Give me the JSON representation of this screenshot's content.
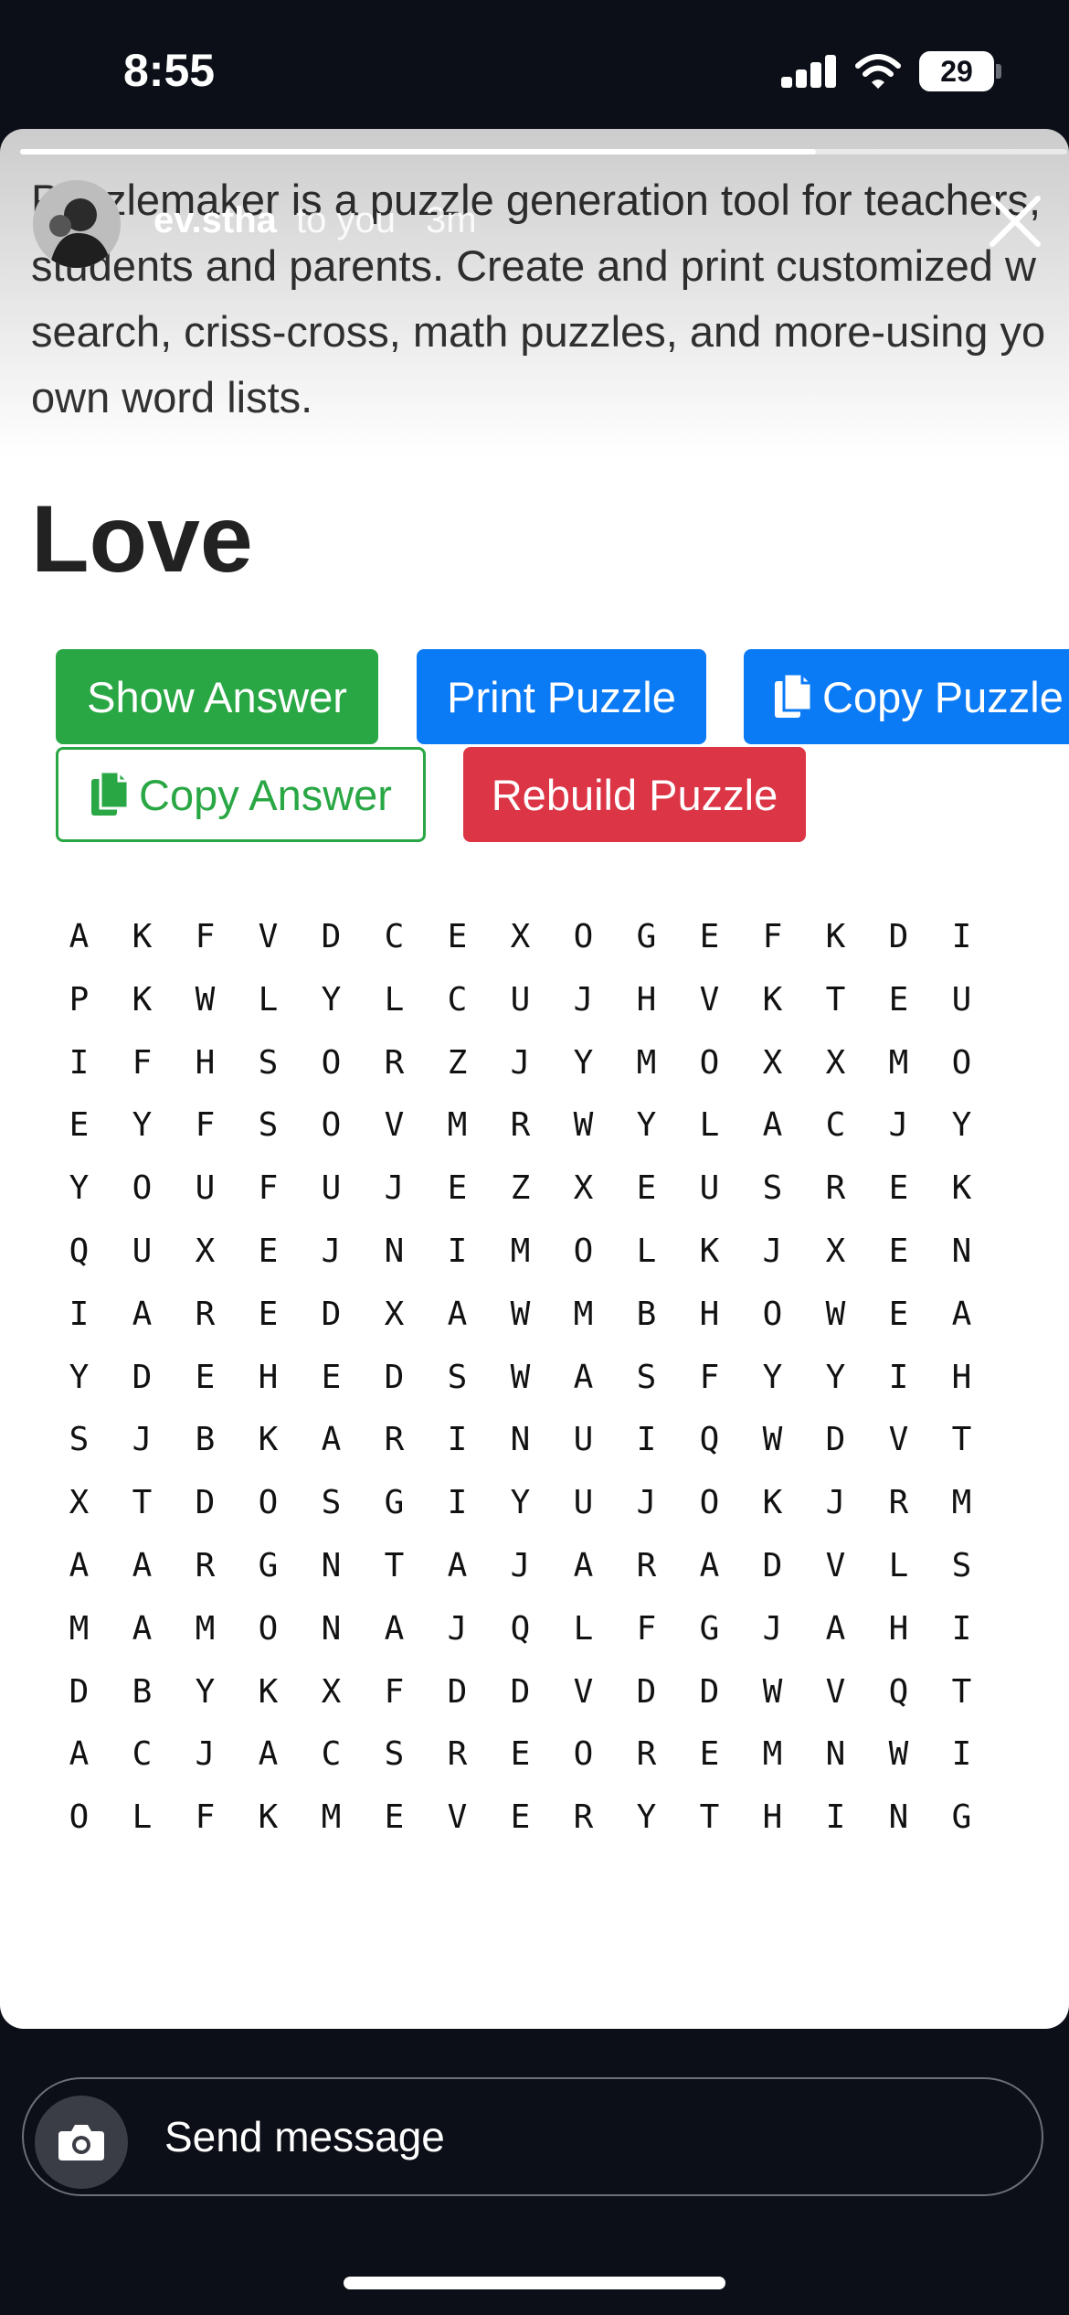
{
  "status_bar": {
    "time": "8:55",
    "battery": "29"
  },
  "story": {
    "progress": 0.76,
    "username": "ev.stha",
    "audience": "to you",
    "age": "3m",
    "intro_lines": [
      "Puzzlemaker is a puzzle generation tool for teachers,",
      "students and parents. Create and print customized w",
      "search, criss-cross, math puzzles, and more-using yo",
      "own word lists."
    ],
    "title": "Love",
    "buttons": {
      "show_answer": "Show Answer",
      "print_puzzle": "Print Puzzle",
      "copy_puzzle": "Copy Puzzle",
      "copy_answer": "Copy Answer",
      "rebuild_puzzle": "Rebuild Puzzle"
    },
    "grid": [
      [
        "A",
        "K",
        "F",
        "V",
        "D",
        "C",
        "E",
        "X",
        "O",
        "G",
        "E",
        "F",
        "K",
        "D",
        "I"
      ],
      [
        "P",
        "K",
        "W",
        "L",
        "Y",
        "L",
        "C",
        "U",
        "J",
        "H",
        "V",
        "K",
        "T",
        "E",
        "U"
      ],
      [
        "I",
        "F",
        "H",
        "S",
        "O",
        "R",
        "Z",
        "J",
        "Y",
        "M",
        "O",
        "X",
        "X",
        "M",
        "O"
      ],
      [
        "E",
        "Y",
        "F",
        "S",
        "O",
        "V",
        "M",
        "R",
        "W",
        "Y",
        "L",
        "A",
        "C",
        "J",
        "Y"
      ],
      [
        "Y",
        "O",
        "U",
        "F",
        "U",
        "J",
        "E",
        "Z",
        "X",
        "E",
        "U",
        "S",
        "R",
        "E",
        "K"
      ],
      [
        "Q",
        "U",
        "X",
        "E",
        "J",
        "N",
        "I",
        "M",
        "O",
        "L",
        "K",
        "J",
        "X",
        "E",
        "N"
      ],
      [
        "I",
        "A",
        "R",
        "E",
        "D",
        "X",
        "A",
        "W",
        "M",
        "B",
        "H",
        "O",
        "W",
        "E",
        "A"
      ],
      [
        "Y",
        "D",
        "E",
        "H",
        "E",
        "D",
        "S",
        "W",
        "A",
        "S",
        "F",
        "Y",
        "Y",
        "I",
        "H"
      ],
      [
        "S",
        "J",
        "B",
        "K",
        "A",
        "R",
        "I",
        "N",
        "U",
        "I",
        "Q",
        "W",
        "D",
        "V",
        "T"
      ],
      [
        "X",
        "T",
        "D",
        "O",
        "S",
        "G",
        "I",
        "Y",
        "U",
        "J",
        "O",
        "K",
        "J",
        "R",
        "M"
      ],
      [
        "A",
        "A",
        "R",
        "G",
        "N",
        "T",
        "A",
        "J",
        "A",
        "R",
        "A",
        "D",
        "V",
        "L",
        "S"
      ],
      [
        "M",
        "A",
        "M",
        "O",
        "N",
        "A",
        "J",
        "Q",
        "L",
        "F",
        "G",
        "J",
        "A",
        "H",
        "I"
      ],
      [
        "D",
        "B",
        "Y",
        "K",
        "X",
        "F",
        "D",
        "D",
        "V",
        "D",
        "D",
        "W",
        "V",
        "Q",
        "T"
      ],
      [
        "A",
        "C",
        "J",
        "A",
        "C",
        "S",
        "R",
        "E",
        "O",
        "R",
        "E",
        "M",
        "N",
        "W",
        "I"
      ],
      [
        "O",
        "L",
        "F",
        "K",
        "M",
        "E",
        "V",
        "E",
        "R",
        "Y",
        "T",
        "H",
        "I",
        "N",
        "G"
      ]
    ]
  },
  "message_bar": {
    "placeholder": "Send message"
  },
  "icons": [
    "signal-icon",
    "wifi-icon",
    "battery-icon",
    "close-icon",
    "copy-icon",
    "camera-icon"
  ],
  "colors": {
    "green": "#2aa745",
    "blue": "#0b7af5",
    "red": "#dc3545",
    "background": "#0c0f17"
  }
}
